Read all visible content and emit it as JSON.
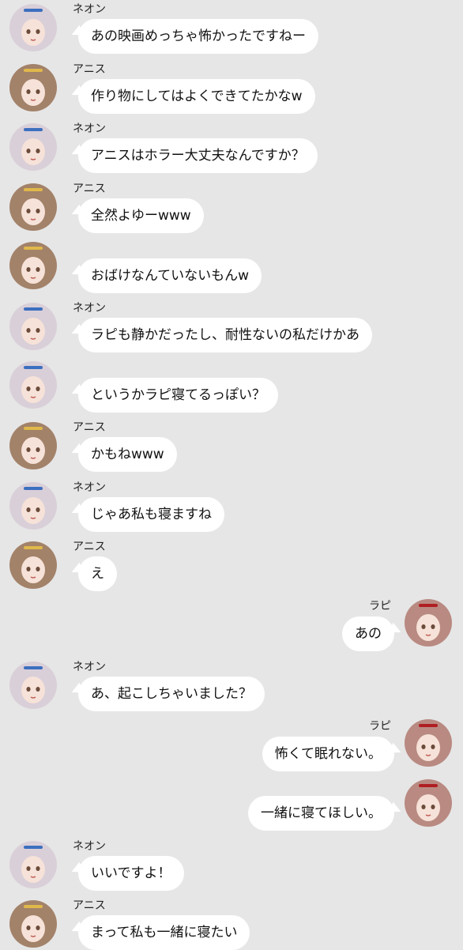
{
  "senders": {
    "neon": {
      "name": "ネオン",
      "icon": "neon-avatar-icon",
      "hair": "#d9cfd8",
      "accent": "#3c6fbf"
    },
    "anis": {
      "name": "アニス",
      "icon": "anis-avatar-icon",
      "hair": "#a3826a",
      "accent": "#e0b84a"
    },
    "rapi": {
      "name": "ラピ",
      "icon": "rapi-avatar-icon",
      "hair": "#b98a82",
      "accent": "#b01e22"
    }
  },
  "messages": [
    {
      "sender": "neon",
      "side": "left",
      "show_name": true,
      "text": "あの映画めっちゃ怖かったですねー"
    },
    {
      "sender": "anis",
      "side": "left",
      "show_name": true,
      "text": "作り物にしてはよくできてたかなw"
    },
    {
      "sender": "neon",
      "side": "left",
      "show_name": true,
      "text": "アニスはホラー大丈夫なんですか？"
    },
    {
      "sender": "anis",
      "side": "left",
      "show_name": true,
      "text": "全然よゆーwww"
    },
    {
      "sender": "anis",
      "side": "left",
      "show_name": false,
      "text": "おばけなんていないもんw"
    },
    {
      "sender": "neon",
      "side": "left",
      "show_name": true,
      "text": "ラピも静かだったし、耐性ないの私だけかあ"
    },
    {
      "sender": "neon",
      "side": "left",
      "show_name": false,
      "text": "というかラピ寝てるっぽい？"
    },
    {
      "sender": "anis",
      "side": "left",
      "show_name": true,
      "text": "かもねwww"
    },
    {
      "sender": "neon",
      "side": "left",
      "show_name": true,
      "text": "じゃあ私も寝ますね"
    },
    {
      "sender": "anis",
      "side": "left",
      "show_name": true,
      "text": "え"
    },
    {
      "sender": "rapi",
      "side": "right",
      "show_name": true,
      "text": "あの"
    },
    {
      "sender": "neon",
      "side": "left",
      "show_name": true,
      "text": "あ、起こしちゃいました？"
    },
    {
      "sender": "rapi",
      "side": "right",
      "show_name": true,
      "text": "怖くて眠れない。"
    },
    {
      "sender": "rapi",
      "side": "right",
      "show_name": false,
      "text": "一緒に寝てほしい。"
    },
    {
      "sender": "neon",
      "side": "left",
      "show_name": true,
      "text": "いいですよ！"
    },
    {
      "sender": "anis",
      "side": "left",
      "show_name": true,
      "text": "まって私も一緒に寝たい"
    }
  ]
}
